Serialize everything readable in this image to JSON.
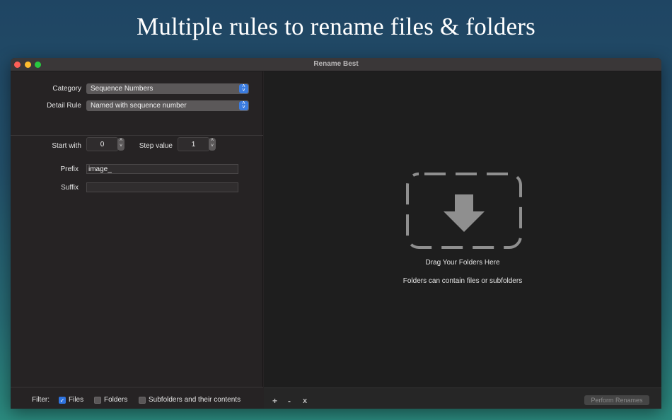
{
  "headline": "Multiple rules to rename files & folders",
  "window": {
    "title": "Rename Best"
  },
  "rule_selector": {
    "category_label": "Category",
    "category_value": "Sequence Numbers",
    "detail_label": "Detail Rule",
    "detail_value": "Named with sequence number"
  },
  "sequence": {
    "start_label": "Start with",
    "start_value": "0",
    "step_label": "Step value",
    "step_value": "1",
    "prefix_label": "Prefix",
    "prefix_value": "image_",
    "suffix_label": "Suffix",
    "suffix_value": ""
  },
  "filter": {
    "label": "Filter:",
    "options": [
      {
        "label": "Files",
        "checked": true
      },
      {
        "label": "Folders",
        "checked": false
      },
      {
        "label": "Subfolders and their contents",
        "checked": false
      }
    ]
  },
  "drop_zone": {
    "icon": "download-arrow-icon",
    "title": "Drag Your Folders Here",
    "subtitle": "Folders can contain files or subfolders"
  },
  "toolbar": {
    "add_label": "+",
    "remove_label": "-",
    "clear_label": "x",
    "perform_label": "Perform Renames"
  },
  "colors": {
    "accent": "#2f74e0",
    "window_bg": "#262324",
    "drop_bg": "#1e1e1e"
  }
}
